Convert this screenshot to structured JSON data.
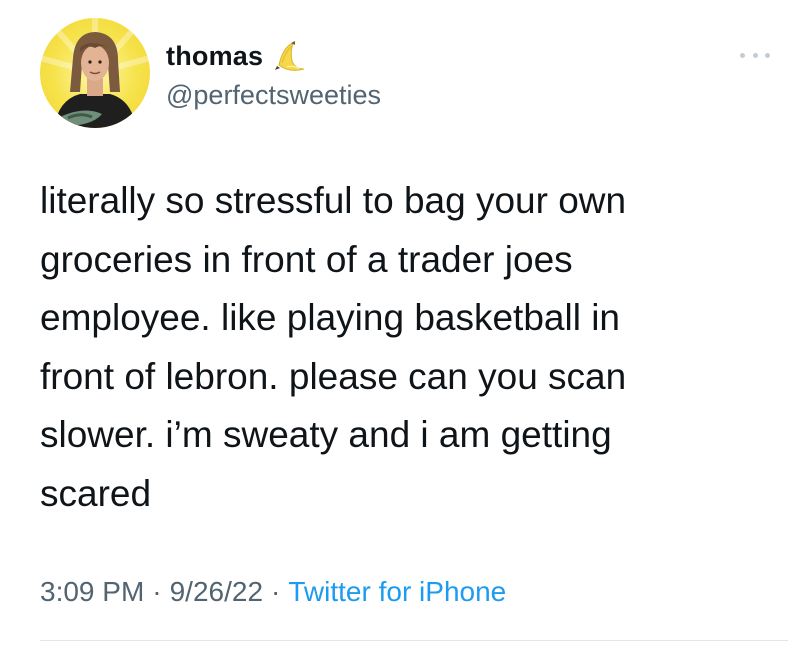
{
  "author": {
    "display_name": "thomas",
    "name_emoji_icon": "banana-icon",
    "handle": "@perfectsweeties",
    "avatar_icon": "avatar-photo"
  },
  "tweet": {
    "text": "literally so stressful to bag your own\ngroceries in front of a trader joes\nemployee. like playing basketball in\nfront of lebron. please can you scan\nslower. i’m sweaty and i am getting\nscared"
  },
  "meta": {
    "time": "3:09 PM",
    "separator": "·",
    "date": "9/26/22",
    "source": "Twitter for iPhone"
  },
  "colors": {
    "text": "#0f1419",
    "secondary": "#536471",
    "accent": "#1d9bf0",
    "avatar_bg": "#f6e24a"
  }
}
